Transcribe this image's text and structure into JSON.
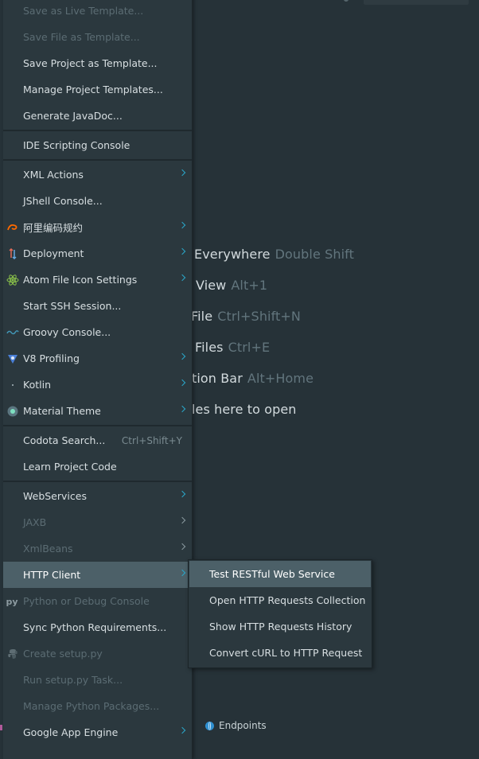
{
  "hints": [
    {
      "text": "Everywhere",
      "shortcut": "Double Shift"
    },
    {
      "text": "View",
      "shortcut": "Alt+1"
    },
    {
      "text": "File",
      "shortcut": "Ctrl+Shift+N"
    },
    {
      "text": "Files",
      "shortcut": "Ctrl+E"
    },
    {
      "text": "tion Bar",
      "shortcut": "Alt+Home"
    },
    {
      "text": "les here to open",
      "shortcut": ""
    }
  ],
  "menu": {
    "items": [
      {
        "label": "Save as Live Template...",
        "disabled": true
      },
      {
        "label": "Save File as Template...",
        "disabled": true
      },
      {
        "label": "Save Project as Template..."
      },
      {
        "label": "Manage Project Templates..."
      },
      {
        "label": "Generate JavaDoc..."
      },
      {
        "label": "IDE Scripting Console"
      },
      {
        "label": "XML Actions",
        "submenu": true
      },
      {
        "label": "JShell Console..."
      },
      {
        "label": "阿里编码规约",
        "submenu": true,
        "icon": "alibaba-icon"
      },
      {
        "label": "Deployment",
        "submenu": true,
        "icon": "deployment-icon"
      },
      {
        "label": "Atom File Icon Settings",
        "submenu": true,
        "icon": "atom-icon"
      },
      {
        "label": "Start SSH Session..."
      },
      {
        "label": "Groovy Console...",
        "icon": "groovy-icon"
      },
      {
        "label": "V8 Profiling",
        "submenu": true,
        "icon": "v8-icon"
      },
      {
        "label": "Kotlin",
        "submenu": true,
        "icon": "kotlin-icon"
      },
      {
        "label": "Material Theme",
        "submenu": true,
        "icon": "material-theme-icon"
      },
      {
        "label": "Codota Search...",
        "shortcut": "Ctrl+Shift+Y"
      },
      {
        "label": "Learn Project Code"
      },
      {
        "label": "WebServices",
        "submenu": true
      },
      {
        "label": "JAXB",
        "submenu": true,
        "disabled": true
      },
      {
        "label": "XmlBeans",
        "submenu": true,
        "disabled": true
      },
      {
        "label": "HTTP Client",
        "submenu": true,
        "selected": true
      },
      {
        "label": "Python or Debug Console",
        "disabled": true,
        "icon": "python-console-icon"
      },
      {
        "label": "Sync Python Requirements..."
      },
      {
        "label": "Create setup.py",
        "disabled": true,
        "icon": "python-icon"
      },
      {
        "label": "Run setup.py Task...",
        "disabled": true
      },
      {
        "label": "Manage Python Packages...",
        "disabled": true
      },
      {
        "label": "Google App Engine",
        "submenu": true
      }
    ]
  },
  "submenu": {
    "items": [
      {
        "label": "Test RESTful Web Service",
        "selected": true
      },
      {
        "label": "Open HTTP Requests Collection"
      },
      {
        "label": "Show HTTP Requests History"
      },
      {
        "label": "Convert cURL to HTTP Request"
      }
    ]
  },
  "toolwindow": {
    "endpoints_label": "Endpoints"
  },
  "colors": {
    "background": "#263238",
    "menu": "#2b383e",
    "selected": "#4c6068",
    "accent": "#2aa6c8"
  }
}
